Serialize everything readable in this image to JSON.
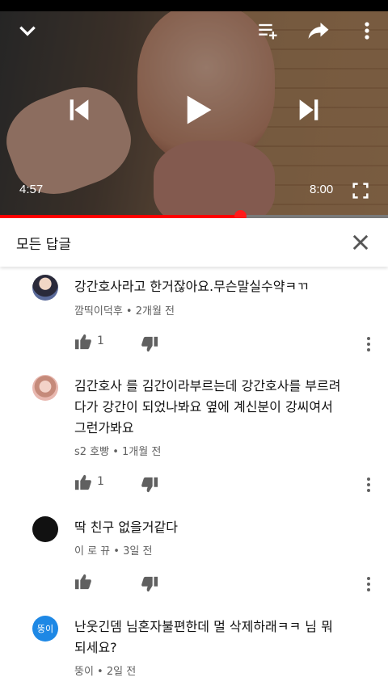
{
  "player": {
    "current_time": "4:57",
    "duration": "8:00",
    "progress_fraction": 0.619
  },
  "panel": {
    "title": "모든 답글"
  },
  "comments": [
    {
      "text": "강간호사라고 한거잖아요.무슨말실수약ㅋㄲ",
      "meta": "깜띡이덕후 • 2개월 전",
      "likes": "1",
      "avatar": "photo"
    },
    {
      "text": "김간호사 를 김간이라부르는데 강간호사를 부르려다가 강간이 되었나봐요 옆에 계신분이 강씨여서 그런가봐요",
      "meta": "s2 호빵 • 1개월 전",
      "likes": "1",
      "avatar": "photo"
    },
    {
      "text": "딱 친구 없을거같다",
      "meta": "이 로 뀨 • 3일 전",
      "likes": "",
      "avatar": "dark"
    },
    {
      "text": "난웃긴뎀 님혼자불편한데 멀 삭제하래ㅋㅋ 님 뭐 되세요?",
      "meta": "뚱이 • 2일 전",
      "likes": "",
      "avatar_text": "뚱이",
      "avatar_color": "#1e88e5"
    }
  ]
}
